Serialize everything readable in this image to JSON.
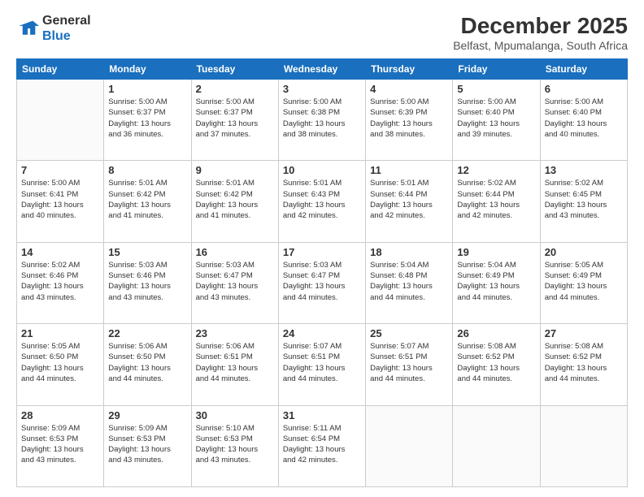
{
  "logo": {
    "line1": "General",
    "line2": "Blue"
  },
  "title": "December 2025",
  "subtitle": "Belfast, Mpumalanga, South Africa",
  "days_of_week": [
    "Sunday",
    "Monday",
    "Tuesday",
    "Wednesday",
    "Thursday",
    "Friday",
    "Saturday"
  ],
  "weeks": [
    [
      {
        "day": "",
        "info": ""
      },
      {
        "day": "1",
        "info": "Sunrise: 5:00 AM\nSunset: 6:37 PM\nDaylight: 13 hours\nand 36 minutes."
      },
      {
        "day": "2",
        "info": "Sunrise: 5:00 AM\nSunset: 6:37 PM\nDaylight: 13 hours\nand 37 minutes."
      },
      {
        "day": "3",
        "info": "Sunrise: 5:00 AM\nSunset: 6:38 PM\nDaylight: 13 hours\nand 38 minutes."
      },
      {
        "day": "4",
        "info": "Sunrise: 5:00 AM\nSunset: 6:39 PM\nDaylight: 13 hours\nand 38 minutes."
      },
      {
        "day": "5",
        "info": "Sunrise: 5:00 AM\nSunset: 6:40 PM\nDaylight: 13 hours\nand 39 minutes."
      },
      {
        "day": "6",
        "info": "Sunrise: 5:00 AM\nSunset: 6:40 PM\nDaylight: 13 hours\nand 40 minutes."
      }
    ],
    [
      {
        "day": "7",
        "info": "Sunrise: 5:00 AM\nSunset: 6:41 PM\nDaylight: 13 hours\nand 40 minutes."
      },
      {
        "day": "8",
        "info": "Sunrise: 5:01 AM\nSunset: 6:42 PM\nDaylight: 13 hours\nand 41 minutes."
      },
      {
        "day": "9",
        "info": "Sunrise: 5:01 AM\nSunset: 6:42 PM\nDaylight: 13 hours\nand 41 minutes."
      },
      {
        "day": "10",
        "info": "Sunrise: 5:01 AM\nSunset: 6:43 PM\nDaylight: 13 hours\nand 42 minutes."
      },
      {
        "day": "11",
        "info": "Sunrise: 5:01 AM\nSunset: 6:44 PM\nDaylight: 13 hours\nand 42 minutes."
      },
      {
        "day": "12",
        "info": "Sunrise: 5:02 AM\nSunset: 6:44 PM\nDaylight: 13 hours\nand 42 minutes."
      },
      {
        "day": "13",
        "info": "Sunrise: 5:02 AM\nSunset: 6:45 PM\nDaylight: 13 hours\nand 43 minutes."
      }
    ],
    [
      {
        "day": "14",
        "info": "Sunrise: 5:02 AM\nSunset: 6:46 PM\nDaylight: 13 hours\nand 43 minutes."
      },
      {
        "day": "15",
        "info": "Sunrise: 5:03 AM\nSunset: 6:46 PM\nDaylight: 13 hours\nand 43 minutes."
      },
      {
        "day": "16",
        "info": "Sunrise: 5:03 AM\nSunset: 6:47 PM\nDaylight: 13 hours\nand 43 minutes."
      },
      {
        "day": "17",
        "info": "Sunrise: 5:03 AM\nSunset: 6:47 PM\nDaylight: 13 hours\nand 44 minutes."
      },
      {
        "day": "18",
        "info": "Sunrise: 5:04 AM\nSunset: 6:48 PM\nDaylight: 13 hours\nand 44 minutes."
      },
      {
        "day": "19",
        "info": "Sunrise: 5:04 AM\nSunset: 6:49 PM\nDaylight: 13 hours\nand 44 minutes."
      },
      {
        "day": "20",
        "info": "Sunrise: 5:05 AM\nSunset: 6:49 PM\nDaylight: 13 hours\nand 44 minutes."
      }
    ],
    [
      {
        "day": "21",
        "info": "Sunrise: 5:05 AM\nSunset: 6:50 PM\nDaylight: 13 hours\nand 44 minutes."
      },
      {
        "day": "22",
        "info": "Sunrise: 5:06 AM\nSunset: 6:50 PM\nDaylight: 13 hours\nand 44 minutes."
      },
      {
        "day": "23",
        "info": "Sunrise: 5:06 AM\nSunset: 6:51 PM\nDaylight: 13 hours\nand 44 minutes."
      },
      {
        "day": "24",
        "info": "Sunrise: 5:07 AM\nSunset: 6:51 PM\nDaylight: 13 hours\nand 44 minutes."
      },
      {
        "day": "25",
        "info": "Sunrise: 5:07 AM\nSunset: 6:51 PM\nDaylight: 13 hours\nand 44 minutes."
      },
      {
        "day": "26",
        "info": "Sunrise: 5:08 AM\nSunset: 6:52 PM\nDaylight: 13 hours\nand 44 minutes."
      },
      {
        "day": "27",
        "info": "Sunrise: 5:08 AM\nSunset: 6:52 PM\nDaylight: 13 hours\nand 44 minutes."
      }
    ],
    [
      {
        "day": "28",
        "info": "Sunrise: 5:09 AM\nSunset: 6:53 PM\nDaylight: 13 hours\nand 43 minutes."
      },
      {
        "day": "29",
        "info": "Sunrise: 5:09 AM\nSunset: 6:53 PM\nDaylight: 13 hours\nand 43 minutes."
      },
      {
        "day": "30",
        "info": "Sunrise: 5:10 AM\nSunset: 6:53 PM\nDaylight: 13 hours\nand 43 minutes."
      },
      {
        "day": "31",
        "info": "Sunrise: 5:11 AM\nSunset: 6:54 PM\nDaylight: 13 hours\nand 42 minutes."
      },
      {
        "day": "",
        "info": ""
      },
      {
        "day": "",
        "info": ""
      },
      {
        "day": "",
        "info": ""
      }
    ]
  ]
}
